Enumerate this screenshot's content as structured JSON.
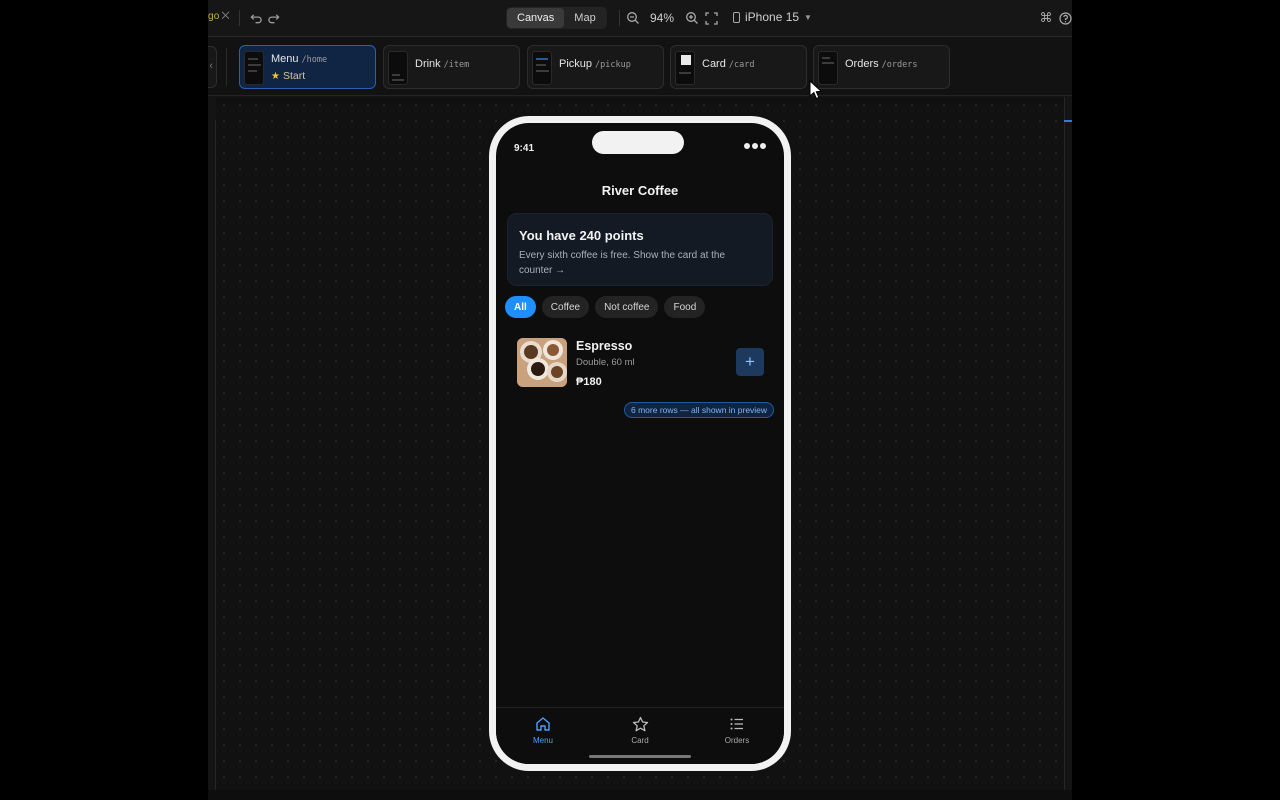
{
  "toolbar": {
    "brand_fragment": "go",
    "modes": [
      {
        "label": "Canvas",
        "active": true
      },
      {
        "label": "Map",
        "active": false
      }
    ],
    "zoom": "94%",
    "device": "iPhone 15"
  },
  "screens": [
    {
      "name": "Menu",
      "route": "/home",
      "start_label": "Start",
      "active": true
    },
    {
      "name": "Drink",
      "route": "/item",
      "active": false
    },
    {
      "name": "Pickup",
      "route": "/pickup",
      "active": false
    },
    {
      "name": "Card",
      "route": "/card",
      "active": false
    },
    {
      "name": "Orders",
      "route": "/orders",
      "active": false
    }
  ],
  "phone": {
    "status_time": "9:41",
    "app_title": "River Coffee",
    "points": {
      "title": "You have 240 points",
      "subtitle": "Every sixth coffee is free. Show the card at the counter →"
    },
    "categories": [
      {
        "label": "All",
        "active": true
      },
      {
        "label": "Coffee",
        "active": false
      },
      {
        "label": "Not coffee",
        "active": false
      },
      {
        "label": "Food",
        "active": false
      }
    ],
    "items": [
      {
        "name": "Espresso",
        "description": "Double, 60 ml",
        "price": "₱180",
        "add_label": "+"
      }
    ],
    "more_rows_badge": "6 more rows — all shown in preview",
    "tabs": [
      {
        "label": "Menu",
        "icon": "home-icon",
        "active": true
      },
      {
        "label": "Card",
        "icon": "star-icon",
        "active": false
      },
      {
        "label": "Orders",
        "icon": "list-icon",
        "active": false
      }
    ]
  },
  "colors": {
    "accent": "#1f8fff",
    "active_screen_border": "#2a5fb0",
    "start_star": "#f2c43a"
  }
}
